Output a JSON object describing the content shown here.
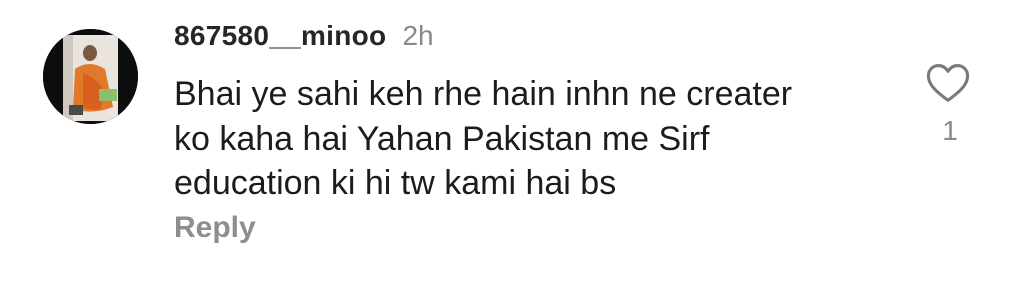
{
  "comment": {
    "username": "867580__minoo",
    "time": "2h",
    "text_lines": [
      "Bhai ye sahi keh rhe hain inhn ne creater",
      "ko kaha hai Yahan Pakistan me Sirf",
      "education ki hi tw kami hai bs"
    ],
    "reply_label": "Reply",
    "like_count": "1",
    "like_icon": "heart-outline-icon",
    "colors": {
      "username": "#262626",
      "secondary_text": "#8a8a8a",
      "reply": "#8e8e8e",
      "avatar_bg": "#0d0d0d"
    }
  }
}
